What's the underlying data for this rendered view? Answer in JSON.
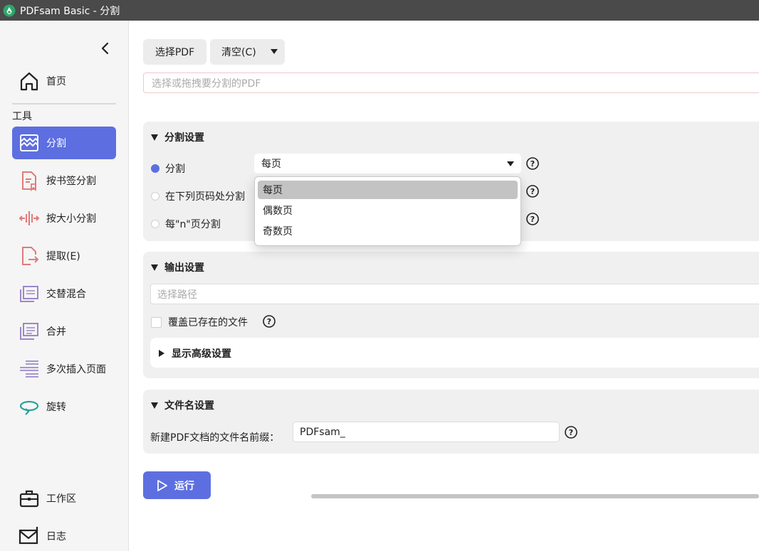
{
  "window": {
    "title": "PDFsam Basic - 分割"
  },
  "sidebar": {
    "home": "首页",
    "section_label": "工具",
    "tools": [
      {
        "label": "分割",
        "icon": "split-icon",
        "active": true
      },
      {
        "label": "按书签分割",
        "icon": "bookmark-split-icon"
      },
      {
        "label": "按大小分割",
        "icon": "size-split-icon"
      },
      {
        "label": "提取(E)",
        "icon": "extract-icon"
      },
      {
        "label": "交替混合",
        "icon": "alternate-mix-icon"
      },
      {
        "label": "合并",
        "icon": "merge-icon"
      },
      {
        "label": "多次插入页面",
        "icon": "insert-pages-icon"
      },
      {
        "label": "旋转",
        "icon": "rotate-icon"
      }
    ],
    "workspace": "工作区",
    "log": "日志"
  },
  "toolbar": {
    "select_pdf": "选择PDF",
    "clear": "清空(C)",
    "pdf_placeholder": "选择或拖拽要分割的PDF"
  },
  "split_settings": {
    "title": "分割设置",
    "options": [
      {
        "label": "分割",
        "checked": true
      },
      {
        "label": "在下列页码处分割",
        "checked": false
      },
      {
        "label": "每\"n\"页分割",
        "checked": false
      }
    ],
    "select_value": "每页",
    "dropdown_options": [
      "每页",
      "偶数页",
      "奇数页"
    ],
    "dropdown_selected": "每页"
  },
  "output_settings": {
    "title": "输出设置",
    "path_placeholder": "选择路径",
    "overwrite_label": "覆盖已存在的文件",
    "overwrite_checked": false,
    "advanced_label": "显示高级设置"
  },
  "filename_settings": {
    "title": "文件名设置",
    "prefix_label": "新建PDF文档的文件名前缀：",
    "prefix_value": "PDFsam_"
  },
  "run": {
    "label": "运行"
  },
  "colors": {
    "accent": "#5d6fe0",
    "titlebar": "#4a4a4a",
    "panel": "#f0f0f0"
  }
}
